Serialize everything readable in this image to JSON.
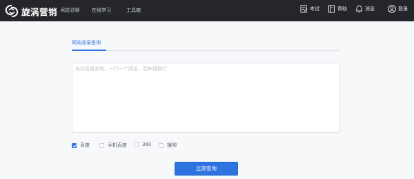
{
  "brand": {
    "name": "旋涡营销"
  },
  "nav": [
    {
      "label": "网站诊断"
    },
    {
      "label": "在线学习"
    },
    {
      "label": "工具箱"
    }
  ],
  "tools": [
    {
      "label": "考试",
      "icon": "exam-icon"
    },
    {
      "label": "帮助",
      "icon": "help-book-icon"
    },
    {
      "label": "消息",
      "icon": "bell-icon"
    },
    {
      "label": "登录",
      "icon": "user-icon"
    }
  ],
  "tab": {
    "label": "网站收录查询"
  },
  "query": {
    "value": "",
    "placeholder": "支持批量查询，一行一个网址，回车键换行"
  },
  "engines": [
    {
      "label": "百度",
      "checked": true
    },
    {
      "label": "手机百度",
      "checked": false
    },
    {
      "label": "360",
      "checked": false
    },
    {
      "label": "搜狗",
      "checked": false
    }
  ],
  "submit": {
    "label": "立即查询"
  },
  "colors": {
    "topbar": "#24262b",
    "accent": "#2f73e0",
    "background": "#f7f8fa"
  }
}
